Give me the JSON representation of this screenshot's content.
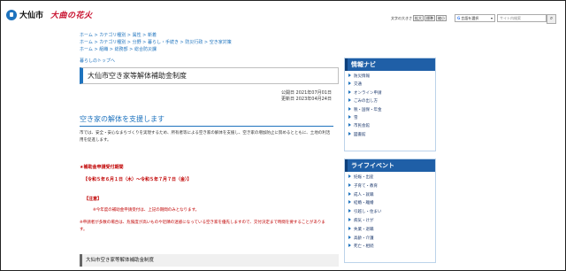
{
  "header": {
    "logo_text": "大仙市",
    "slogan": "大曲の花火",
    "font_size_label": "文字の大きさ",
    "font_size_buttons": [
      "拡大",
      "標準",
      "縮小"
    ],
    "translate_label": "言語を選択",
    "search_placeholder": "サイト内検索"
  },
  "breadcrumbs": [
    "ホーム > カテゴリ種別 > 属性 > 新着",
    "ホーム > カテゴリ種別 > 分野 > 暮らし・手続き > 防災行政 > 空き家対策",
    "ホーム > 組織 > 総務部 > 総合防災課"
  ],
  "back_link": "暮らしのトップへ",
  "main": {
    "title": "大仙市空き家等解体補助金制度",
    "published": "公開日 2021年07月01日",
    "updated": "更新日 2023年04月24日",
    "heading": "空き家の解体を支援します",
    "intro": "市では、安全・安心なまちづくりを実現するため、所有者等による空き家の解体を支援し、空き家の増加防止に努めるとともに、土地の利活用を促進します。",
    "recruit_title": "★補助金申請受付期間",
    "period": "【令和５年６月１日（木）～令和５年７月７日（金）】",
    "notes_heading": "【注意】",
    "note1": "※今年度の補助金申請受付は、上記の期間のみとなります。",
    "note2": "※申請者が多数の場合は、危険度が高いものや近隣の迷惑になっている空き家を優先しますので、交付決定まで時間を要することがあります。",
    "section_box": "大仙市空き家等解体補助金制度"
  },
  "nav_panel": {
    "title": "情報ナビ",
    "items": [
      "防災情報",
      "交通",
      "オンライン申請",
      "ごみの出し方",
      "税・国保・年金",
      "雪",
      "市民会館",
      "図書館"
    ]
  },
  "life_panel": {
    "title": "ライフイベント",
    "items": [
      "妊娠・出産",
      "子育て・教育",
      "成人・就職",
      "結婚・離婚",
      "引越し・住まい",
      "病気・けが",
      "失業・退職",
      "高齢・介護",
      "死亡・相続"
    ]
  },
  "colors": {
    "brand_blue": "#1e73be",
    "panel_blue": "#1f5fa7",
    "alert_red": "#c00000",
    "slogan_red": "#c8102e"
  }
}
